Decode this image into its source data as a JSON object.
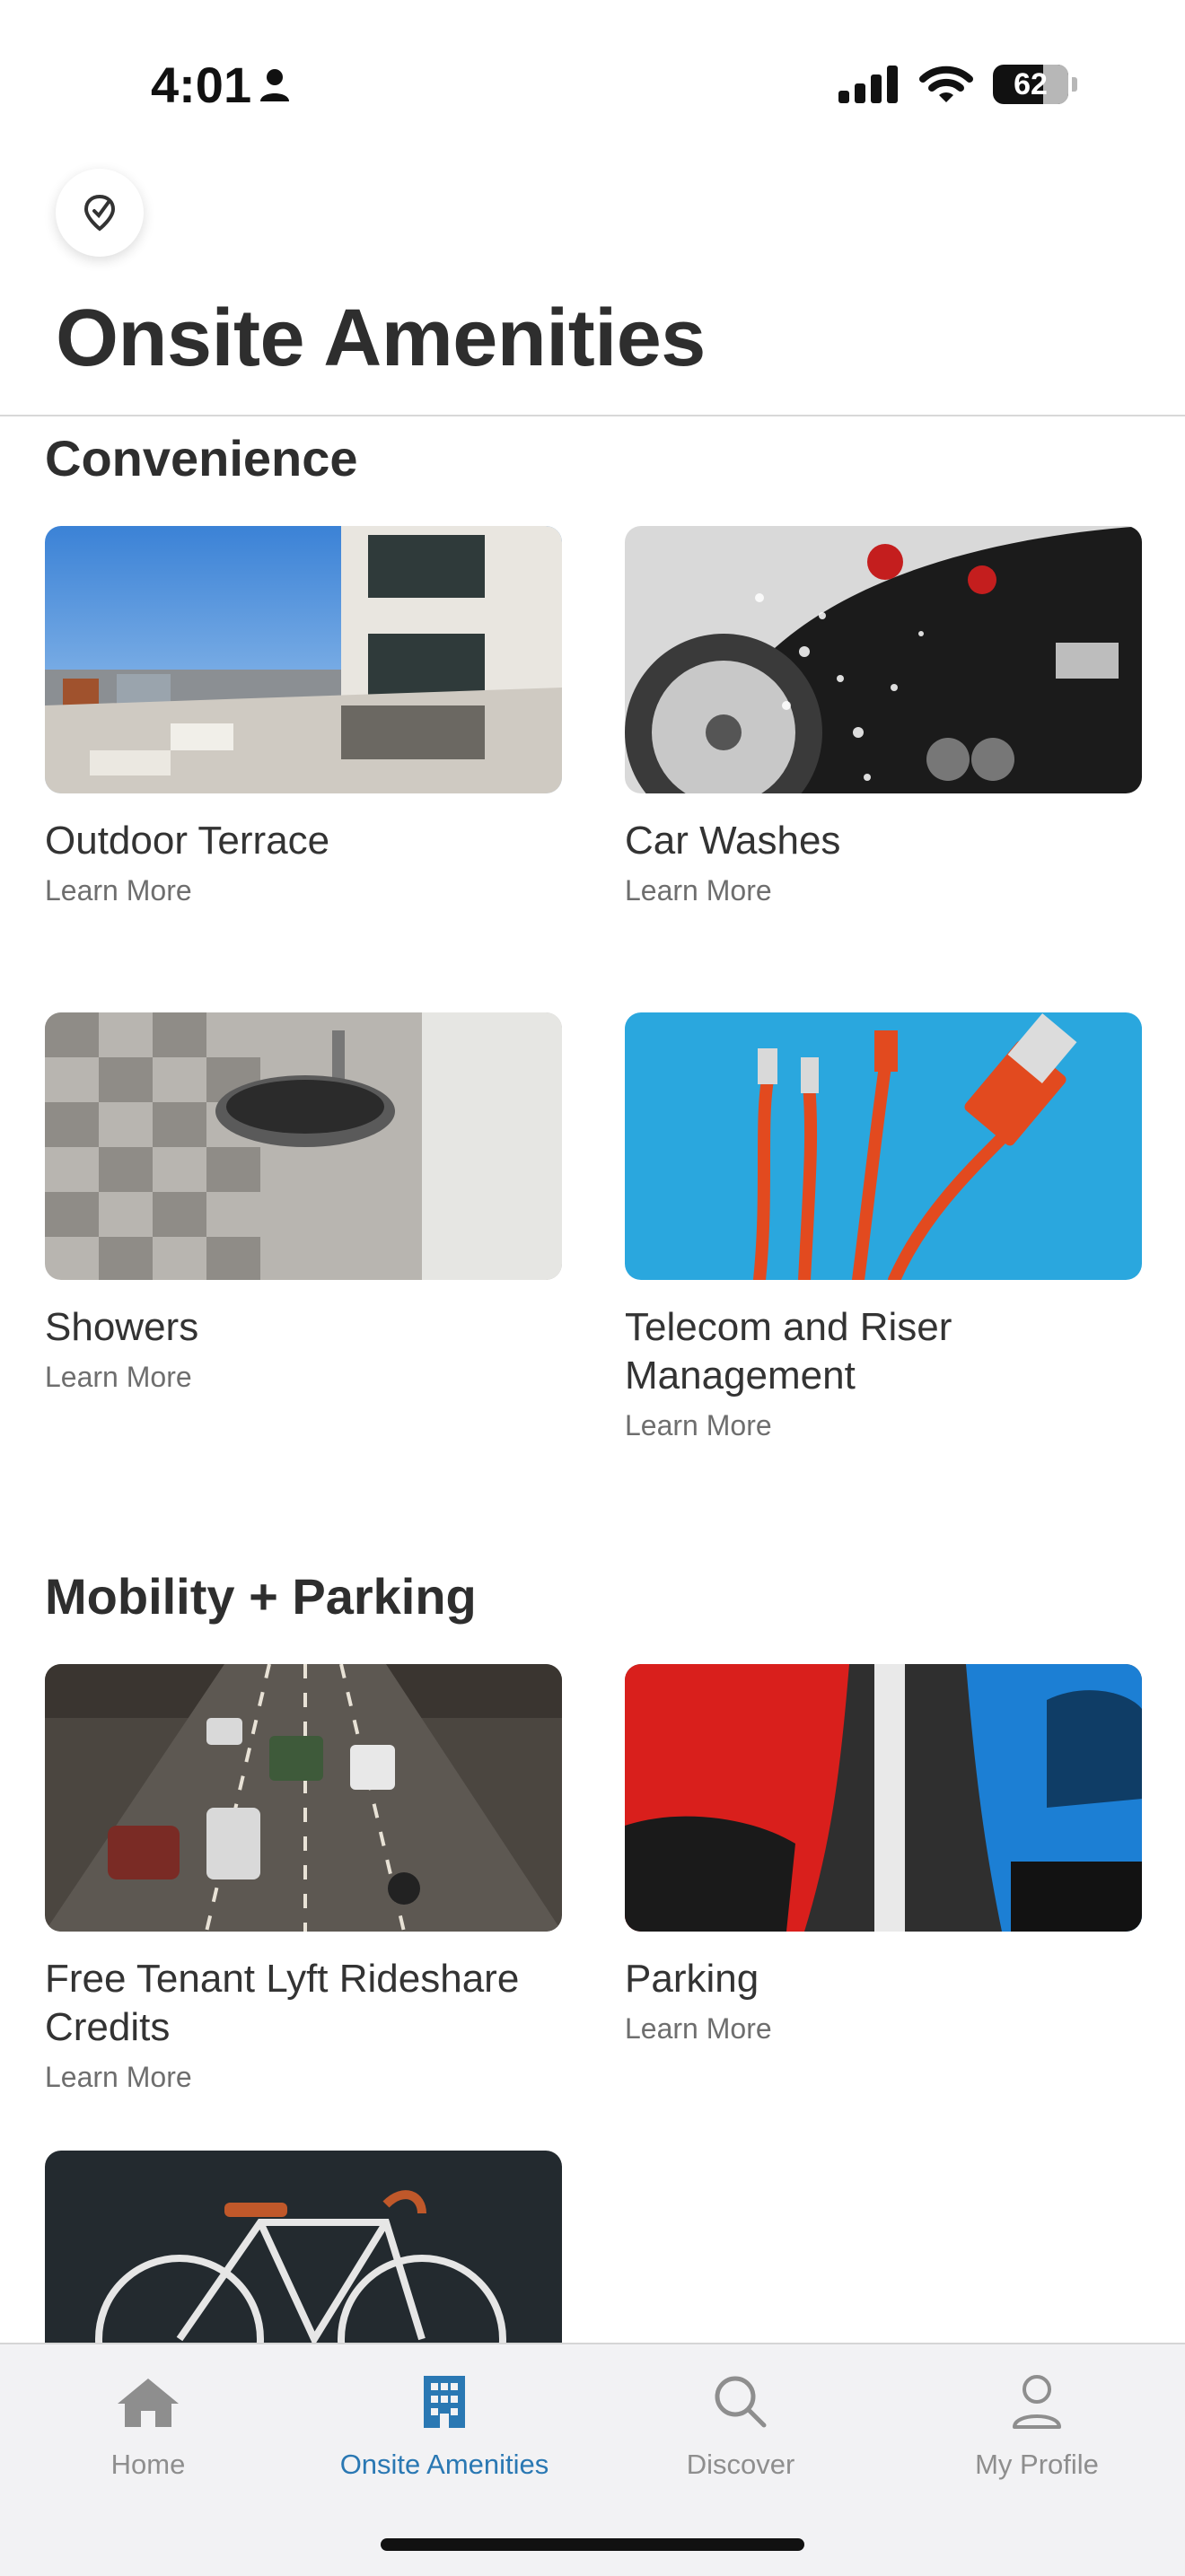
{
  "status_bar": {
    "time": "4:01",
    "battery": "62"
  },
  "header": {
    "title": "Onsite Amenities"
  },
  "sections": [
    {
      "title": "Convenience",
      "items": [
        {
          "name": "Outdoor Terrace",
          "link": "Learn More"
        },
        {
          "name": "Car Washes",
          "link": "Learn More"
        },
        {
          "name": "Showers",
          "link": "Learn More"
        },
        {
          "name": "Telecom and Riser Management",
          "link": "Learn More"
        }
      ]
    },
    {
      "title": "Mobility + Parking",
      "items": [
        {
          "name": "Free Tenant Lyft Rideshare Credits",
          "link": "Learn More"
        },
        {
          "name": "Parking",
          "link": "Learn More"
        },
        {
          "name": "",
          "link": ""
        }
      ]
    }
  ],
  "tabbar": {
    "tabs": [
      {
        "label": "Home",
        "icon": "house-icon"
      },
      {
        "label": "Onsite Amenities",
        "icon": "building-icon",
        "active": true
      },
      {
        "label": "Discover",
        "icon": "search-icon"
      },
      {
        "label": "My Profile",
        "icon": "person-icon"
      }
    ]
  },
  "colors": {
    "accent": "#2a78b3",
    "inactive": "#8e8e8e"
  }
}
